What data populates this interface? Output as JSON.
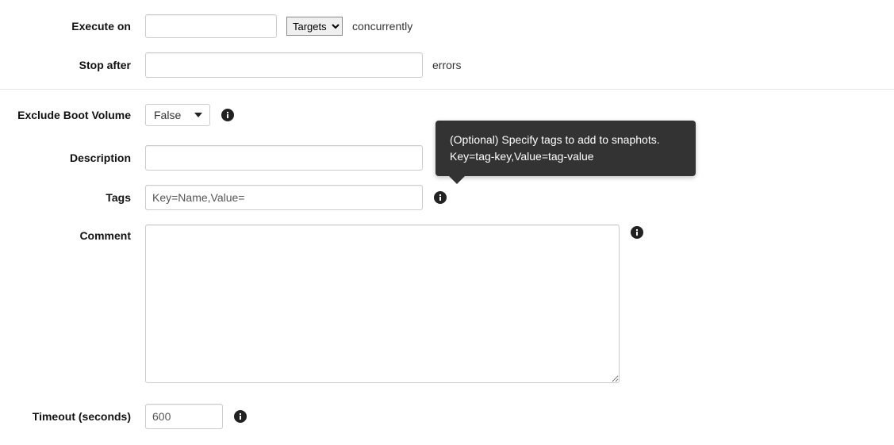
{
  "executeOn": {
    "label": "Execute on",
    "targetsSelectValue": "Targets",
    "suffix": "concurrently"
  },
  "stopAfter": {
    "label": "Stop after",
    "suffix": "errors"
  },
  "excludeBootVolume": {
    "label": "Exclude Boot Volume",
    "value": "False"
  },
  "description": {
    "label": "Description"
  },
  "tags": {
    "label": "Tags",
    "value": "Key=Name,Value=",
    "tooltipLine1": "(Optional) Specify tags to add to snaphots.",
    "tooltipLine2": "Key=tag-key,Value=tag-value"
  },
  "comment": {
    "label": "Comment"
  },
  "timeout": {
    "label": "Timeout (seconds)",
    "value": "600"
  }
}
